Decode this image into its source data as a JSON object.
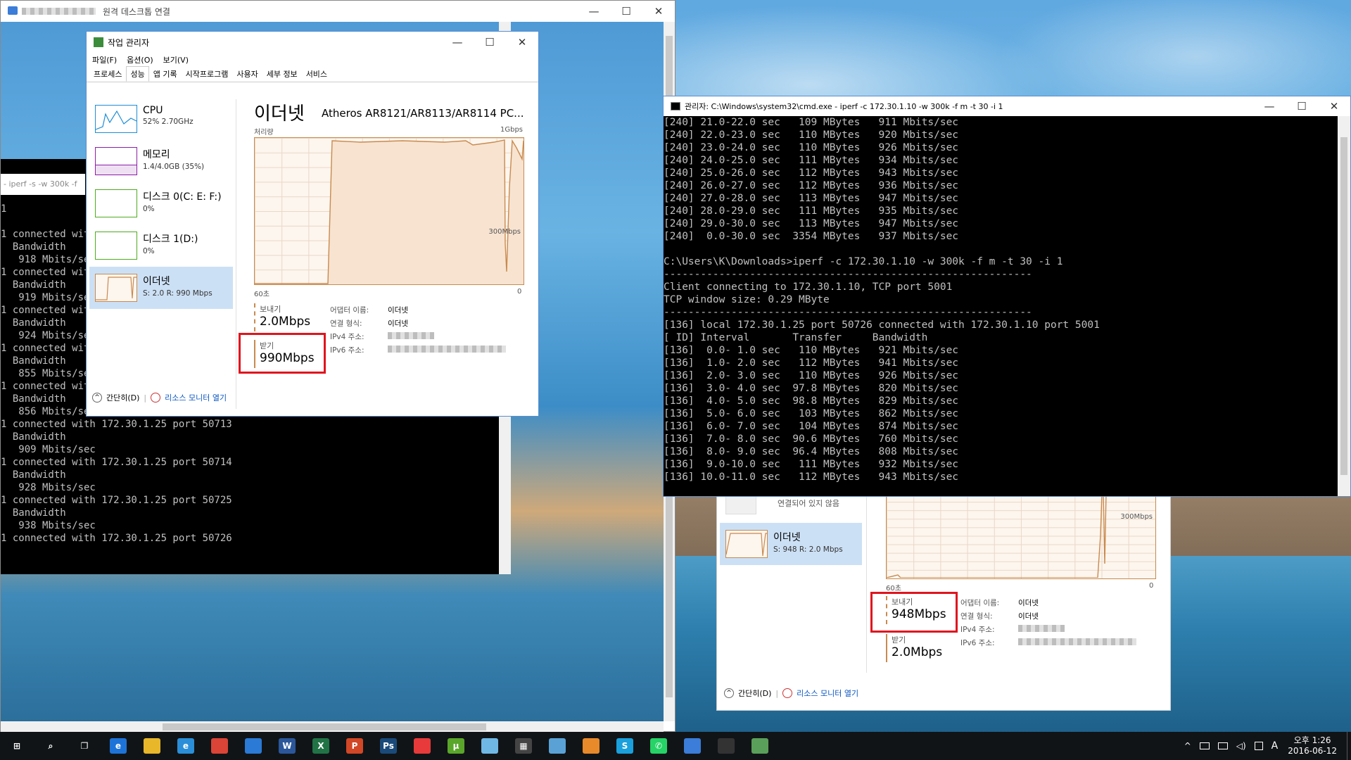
{
  "remote_window": {
    "title": "원격 데스크톱 연결"
  },
  "left_console": {
    "title": "- iperf -s -w 300k -f",
    "lines": [
      "1",
      "",
      "1",
      "",
      "1 connected wit",
      "  Bandwidth",
      "   918 Mbits/se",
      "1 connected wit",
      "  Bandwidth",
      "   919 Mbits/se",
      "1 connected wit",
      "  Bandwidth",
      "   924 Mbits/se",
      "1 connected wit",
      "  Bandwidth",
      "   855 Mbits/se",
      "1 connected wit",
      "  Bandwidth",
      "   856 Mbits/se",
      "1 connected with 172.30.1.25 port 50713",
      "  Bandwidth",
      "   909 Mbits/sec",
      "1 connected with 172.30.1.25 port 50714",
      "  Bandwidth",
      "   928 Mbits/sec",
      "1 connected with 172.30.1.25 port 50725",
      "  Bandwidth",
      "   938 Mbits/sec",
      "1 connected with 172.30.1.25 port 50726"
    ]
  },
  "task_manager": {
    "title": "작업 관리자",
    "menu": [
      "파일(F)",
      "옵션(O)",
      "보기(V)"
    ],
    "tabs": [
      "프로세스",
      "성능",
      "앱 기록",
      "시작프로그램",
      "사용자",
      "세부 정보",
      "서비스"
    ],
    "sidebar": [
      {
        "name": "CPU",
        "sub": "52% 2.70GHz"
      },
      {
        "name": "메모리",
        "sub": "1.4/4.0GB (35%)"
      },
      {
        "name": "디스크 0(C: E: F:)",
        "sub": "0%"
      },
      {
        "name": "디스크 1(D:)",
        "sub": "0%"
      },
      {
        "name": "이더넷",
        "sub": "S: 2.0 R: 990 Mbps"
      }
    ],
    "heading": "이더넷",
    "adapter": "Atheros AR8121/AR8113/AR8114 PC...",
    "throughput_label": "처리량",
    "max_label": "1Gbps",
    "mid_label": "300Mbps",
    "time_label": "60초",
    "zero_label": "0",
    "send_label": "보내기",
    "send_value": "2.0Mbps",
    "recv_label": "받기",
    "recv_value": "990Mbps",
    "info": [
      {
        "k": "어댑터 이름:",
        "v": "이더넷"
      },
      {
        "k": "연결 형식:",
        "v": "이더넷"
      },
      {
        "k": "IPv4 주소:",
        "v": ""
      },
      {
        "k": "IPv6 주소:",
        "v": ""
      }
    ],
    "fewer_details": "간단히(D)",
    "resource_monitor": "리소스 모니터 열기"
  },
  "task_manager2": {
    "disconnected": "연결되어 있지 않음",
    "side_name": "이더넷",
    "side_sub": "S: 948 R: 2.0 Mbps",
    "mid_label": "300Mbps",
    "time_label": "60초",
    "zero_label": "0",
    "send_label": "보내기",
    "send_value": "948Mbps",
    "recv_label": "받기",
    "recv_value": "2.0Mbps",
    "info": [
      {
        "k": "어댑터 이름:",
        "v": "이더넷"
      },
      {
        "k": "연결 형식:",
        "v": "이더넷"
      },
      {
        "k": "IPv4 주소:",
        "v": ""
      },
      {
        "k": "IPv6 주소:",
        "v": ""
      }
    ],
    "fewer_details": "간단히(D)",
    "resource_monitor": "리소스 모니터 열기"
  },
  "right_console": {
    "title": "관리자: C:\\Windows\\system32\\cmd.exe - iperf  -c 172.30.1.10 -w 300k -f m -t 30 -i 1",
    "lines": [
      "[240] 21.0-22.0 sec   109 MBytes   911 Mbits/sec",
      "[240] 22.0-23.0 sec   110 MBytes   920 Mbits/sec",
      "[240] 23.0-24.0 sec   110 MBytes   926 Mbits/sec",
      "[240] 24.0-25.0 sec   111 MBytes   934 Mbits/sec",
      "[240] 25.0-26.0 sec   112 MBytes   943 Mbits/sec",
      "[240] 26.0-27.0 sec   112 MBytes   936 Mbits/sec",
      "[240] 27.0-28.0 sec   113 MBytes   947 Mbits/sec",
      "[240] 28.0-29.0 sec   111 MBytes   935 Mbits/sec",
      "[240] 29.0-30.0 sec   113 MBytes   947 Mbits/sec",
      "[240]  0.0-30.0 sec  3354 MBytes   937 Mbits/sec",
      "",
      "C:\\Users\\K\\Downloads>iperf -c 172.30.1.10 -w 300k -f m -t 30 -i 1",
      "------------------------------------------------------------",
      "Client connecting to 172.30.1.10, TCP port 5001",
      "TCP window size: 0.29 MByte",
      "------------------------------------------------------------",
      "[136] local 172.30.1.25 port 50726 connected with 172.30.1.10 port 5001",
      "[ ID] Interval       Transfer     Bandwidth",
      "[136]  0.0- 1.0 sec   110 MBytes   921 Mbits/sec",
      "[136]  1.0- 2.0 sec   112 MBytes   941 Mbits/sec",
      "[136]  2.0- 3.0 sec   110 MBytes   926 Mbits/sec",
      "[136]  3.0- 4.0 sec  97.8 MBytes   820 Mbits/sec",
      "[136]  4.0- 5.0 sec  98.8 MBytes   829 Mbits/sec",
      "[136]  5.0- 6.0 sec   103 MBytes   862 Mbits/sec",
      "[136]  6.0- 7.0 sec   104 MBytes   874 Mbits/sec",
      "[136]  7.0- 8.0 sec  90.6 MBytes   760 Mbits/sec",
      "[136]  8.0- 9.0 sec  96.4 MBytes   808 Mbits/sec",
      "[136]  9.0-10.0 sec   111 MBytes   932 Mbits/sec",
      "[136] 10.0-11.0 sec   112 MBytes   943 Mbits/sec"
    ]
  },
  "taskbar": {
    "time": "오후 1:26",
    "date": "2016-06-12",
    "ime": "A",
    "apps": [
      "start-icon",
      "search-icon",
      "task-view-icon",
      "edge-icon",
      "file-explorer-icon",
      "ie-icon",
      "chrome-icon",
      "store-icon",
      "word-icon",
      "excel-icon",
      "powerpoint-icon",
      "photoshop-icon",
      "camera-icon",
      "utorrent-icon",
      "notepad-icon",
      "calculator-icon",
      "paint-icon",
      "media-icon",
      "skype-icon",
      "whatsapp-icon",
      "remote-desktop-icon",
      "cmd-icon",
      "task-manager-icon"
    ]
  }
}
